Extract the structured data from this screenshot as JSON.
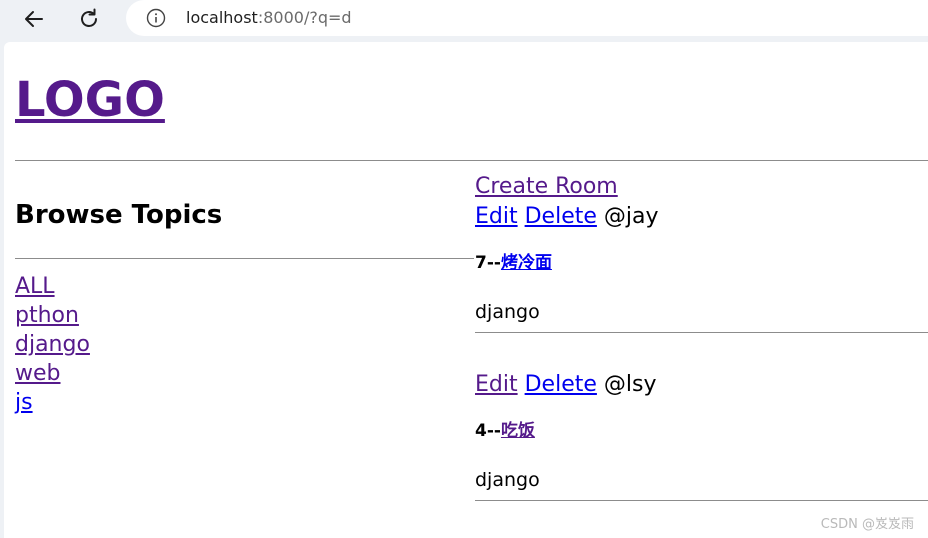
{
  "browser": {
    "url_host": "localhost",
    "url_rest": ":8000/?q=d"
  },
  "header": {
    "logo": "LOGO"
  },
  "sidebar": {
    "title": "Browse Topics",
    "topics": [
      {
        "label": "ALL",
        "visited": true
      },
      {
        "label": "pthon",
        "visited": true
      },
      {
        "label": "django",
        "visited": true
      },
      {
        "label": "web",
        "visited": true
      },
      {
        "label": "js",
        "visited": false
      }
    ]
  },
  "main": {
    "create_room_label": "Create Room",
    "rooms": [
      {
        "edit_label": "Edit",
        "delete_label": "Delete",
        "host": "@jay",
        "id": "7--",
        "name": "烤冷面",
        "topic": "django"
      },
      {
        "edit_label": "Edit",
        "delete_label": "Delete",
        "host": "@lsy",
        "id": "4--",
        "name": "吃饭",
        "topic": "django"
      }
    ]
  },
  "watermark": "CSDN @岌岌雨",
  "colors": {
    "link_visited": "#551a8b",
    "link_unvisited": "#0000ee",
    "chrome_bg": "#eef1f5"
  },
  "icons": [
    "back-arrow-icon",
    "reload-icon",
    "info-icon"
  ]
}
